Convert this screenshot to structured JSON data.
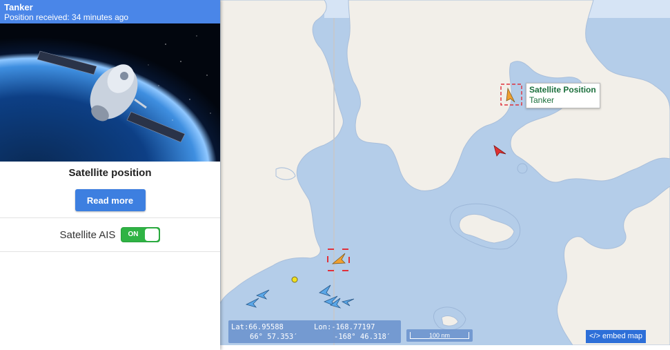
{
  "panel": {
    "vessel_name": "Tanker",
    "position_received": "Position received: 34 minutes ago",
    "photo_subject": "satellite in orbit",
    "title": "Satellite position",
    "read_more_label": "Read more",
    "ais_label": "Satellite AIS",
    "ais_toggle_state": "ON"
  },
  "map": {
    "popup": {
      "title": "Satellite Position",
      "subtitle": "Tanker"
    },
    "coordinates": {
      "lat_decimal": "Lat:66.95588",
      "lat_dms": "66° 57.353′",
      "lon_decimal": "Lon:-168.77197",
      "lon_dms": "-168° 46.318′"
    },
    "scale_label": "100 nm",
    "embed_label": "</> embed map"
  },
  "colors": {
    "header": "#4a86e8",
    "button": "#3d7fe0",
    "toggle_on": "#2fb344",
    "sea": "#b4cde9",
    "land": "#f2efe9",
    "popup_text": "#1b6f3c",
    "selection_box": "#e0303a",
    "vessel_tanker": "#f0a030",
    "vessel_other": "#5aa7e8",
    "vessel_red": "#e03030"
  },
  "icons": [
    "satellite-photo",
    "tanker-arrow-icon",
    "selection-box",
    "vessel-arrow-icon",
    "embed-code-icon"
  ]
}
